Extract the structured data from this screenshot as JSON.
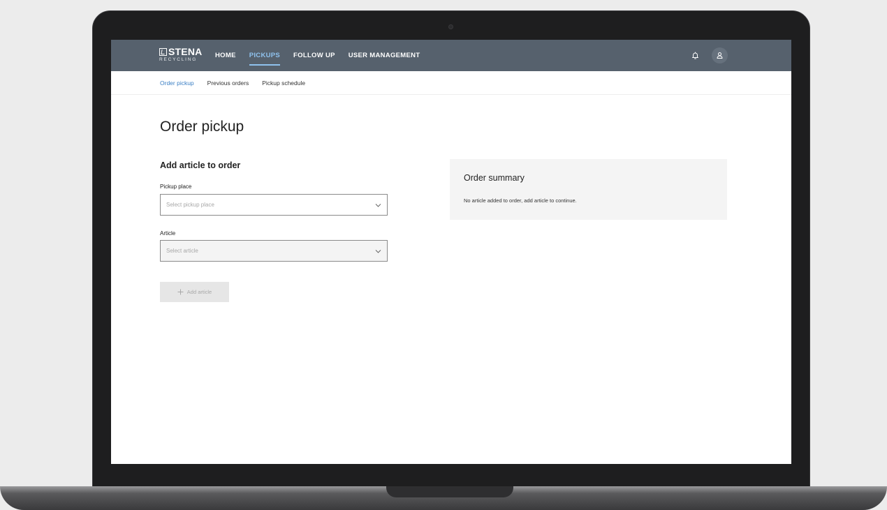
{
  "brand": {
    "name": "STENA",
    "subtitle": "RECYCLING"
  },
  "nav": {
    "items": [
      {
        "label": "HOME",
        "active": false
      },
      {
        "label": "PICKUPS",
        "active": true
      },
      {
        "label": "FOLLOW UP",
        "active": false
      },
      {
        "label": "USER MANAGEMENT",
        "active": false
      }
    ],
    "active_color": "#8fc2ee",
    "bar_color": "#56616d"
  },
  "subnav": {
    "items": [
      {
        "label": "Order pickup",
        "active": true
      },
      {
        "label": "Previous orders",
        "active": false
      },
      {
        "label": "Pickup schedule",
        "active": false
      }
    ]
  },
  "page": {
    "title": "Order pickup",
    "section_title": "Add article to order",
    "pickup_place": {
      "label": "Pickup place",
      "placeholder": "Select pickup place"
    },
    "article": {
      "label": "Article",
      "placeholder": "Select article"
    },
    "add_button": "Add article"
  },
  "summary": {
    "title": "Order summary",
    "empty_text": "No article added to order, add article to continue."
  },
  "icons": [
    "bell-icon",
    "user-icon",
    "chevron-down-icon",
    "plus-icon"
  ]
}
